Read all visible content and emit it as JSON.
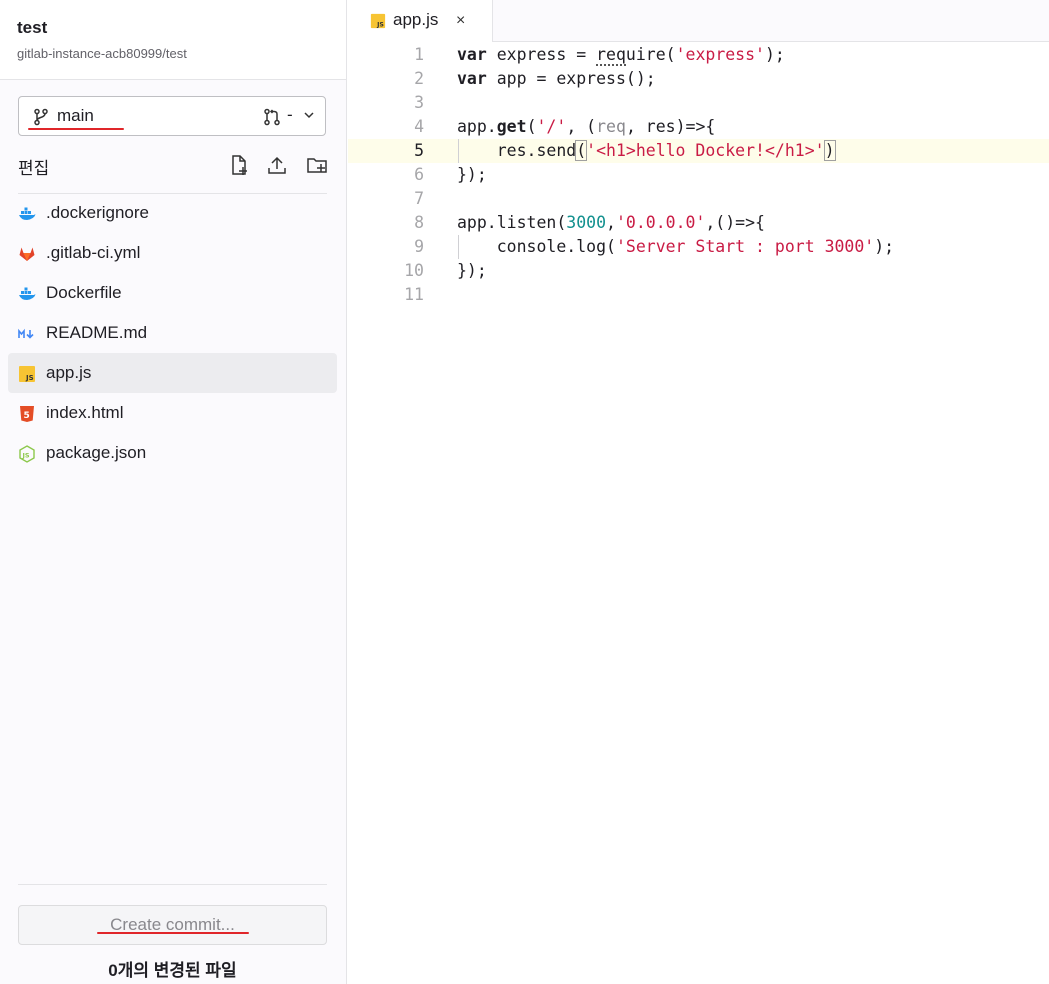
{
  "project": {
    "name": "test",
    "path": "gitlab-instance-acb80999/test"
  },
  "branch": {
    "name": "main",
    "mr_label": "-"
  },
  "toolbar": {
    "edit_label": "편집"
  },
  "files": [
    {
      "name": ".dockerignore",
      "icon": "docker-icon"
    },
    {
      "name": ".gitlab-ci.yml",
      "icon": "gitlab-icon"
    },
    {
      "name": "Dockerfile",
      "icon": "docker-icon"
    },
    {
      "name": "README.md",
      "icon": "markdown-icon"
    },
    {
      "name": "app.js",
      "icon": "js-icon",
      "active": true
    },
    {
      "name": "index.html",
      "icon": "html5-icon"
    },
    {
      "name": "package.json",
      "icon": "nodejs-icon"
    }
  ],
  "commit": {
    "button_label": "Create commit...",
    "changed_files": "0개의 변경된 파일"
  },
  "tab": {
    "name": "app.js",
    "close": "×"
  },
  "editor": {
    "current_line": 5,
    "lines": [
      "var express = require('express');",
      "var app = express();",
      "",
      "app.get('/', (req, res)=>{",
      "    res.send('<h1>hello Docker!</h1>')",
      "});",
      "",
      "app.listen(3000,'0.0.0.0',()=>{",
      "    console.log('Server Start : port 3000');",
      "});",
      ""
    ],
    "line_numbers": [
      "1",
      "2",
      "3",
      "4",
      "5",
      "6",
      "7",
      "8",
      "9",
      "10",
      "11"
    ]
  },
  "colors": {
    "annotation": "#e0262a",
    "string": "#c91c45",
    "number": "#12908e",
    "current_line": "#fefdea"
  }
}
